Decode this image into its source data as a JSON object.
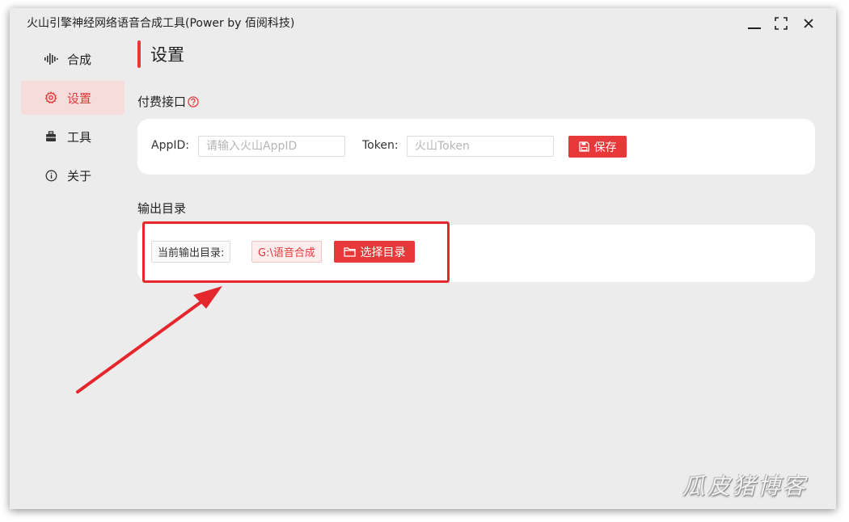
{
  "window": {
    "title": "火山引擎神经网络语音合成工具(Power by 佰阅科技)"
  },
  "sidebar": {
    "items": [
      {
        "label": "合成",
        "icon": "waveform-icon",
        "active": false
      },
      {
        "label": "设置",
        "icon": "gear-icon",
        "active": true
      },
      {
        "label": "工具",
        "icon": "toolbox-icon",
        "active": false
      },
      {
        "label": "关于",
        "icon": "info-icon",
        "active": false
      }
    ]
  },
  "main": {
    "page_title": "设置",
    "paid_api": {
      "section_label": "付费接口",
      "appid_label": "AppID:",
      "appid_placeholder": "请输入火山AppID",
      "appid_value": "",
      "token_label": "Token:",
      "token_placeholder": "火山Token",
      "token_value": "",
      "save_label": "保存"
    },
    "output_dir": {
      "section_label": "输出目录",
      "current_label": "当前输出目录:",
      "current_value": "G:\\语音合成",
      "choose_label": "选择目录"
    }
  },
  "watermark": "瓜皮猪博客",
  "colors": {
    "accent": "#e8393a",
    "active_bg": "#f7dcdc",
    "window_bg": "#edecec",
    "annotation": "#e5262c"
  }
}
